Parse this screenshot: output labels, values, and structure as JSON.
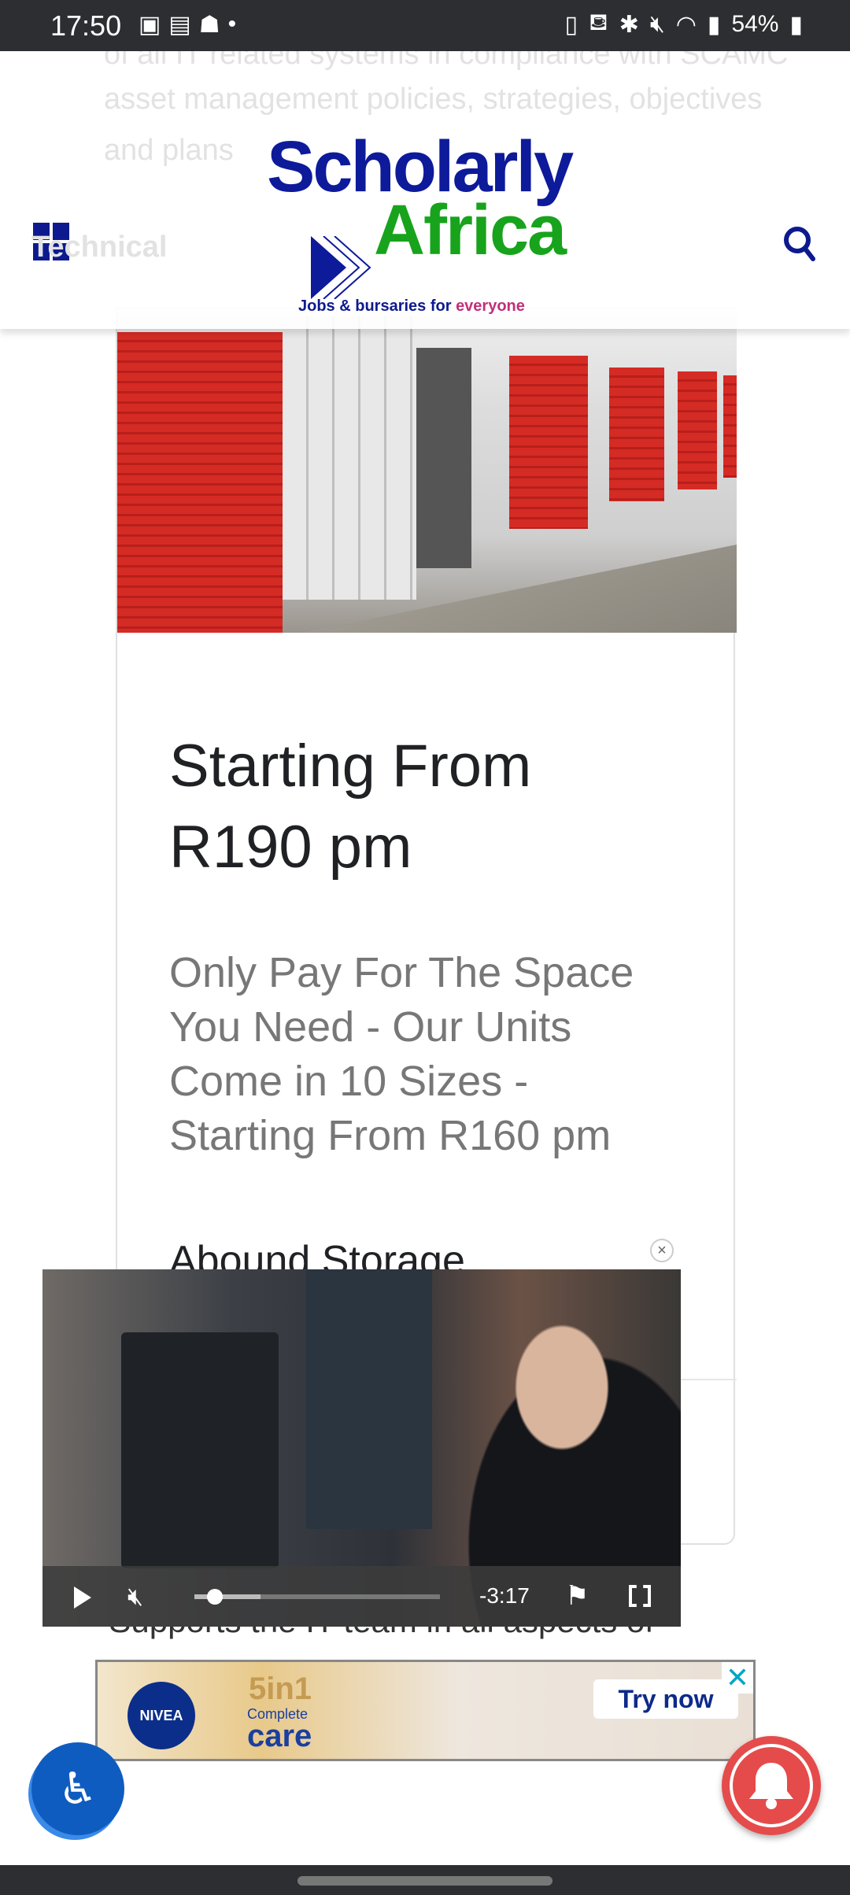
{
  "status_bar": {
    "time": "17:50",
    "battery": "54%"
  },
  "background_text": {
    "line1": "of all IT related systems in compliance with SCAMC",
    "line2": "asset management policies, strategies, objectives",
    "line3": "and plans",
    "heading": "Technical"
  },
  "header": {
    "logo_line1": "Scholarly",
    "logo_line2": "Africa",
    "tagline_a": "Jobs & bursaries for ",
    "tagline_b": "everyone"
  },
  "ad": {
    "headline": "Starting From R190 pm",
    "description": "Only Pay For The Space You Need - Our Units Come in 10 Sizes - Starting From R160 pm",
    "advertiser": "Abound Storage"
  },
  "article": {
    "bullet": "Supports the IT team in all aspects of"
  },
  "video": {
    "remaining": "-3:17",
    "progress": 0.05,
    "buffered": 0.27,
    "close": "×"
  },
  "banner_ad": {
    "brand": "NIVEA",
    "promo": "5in1",
    "promo_sub1": "Complete",
    "promo_sub2": "care",
    "cta": "Try now",
    "close": "✕"
  }
}
